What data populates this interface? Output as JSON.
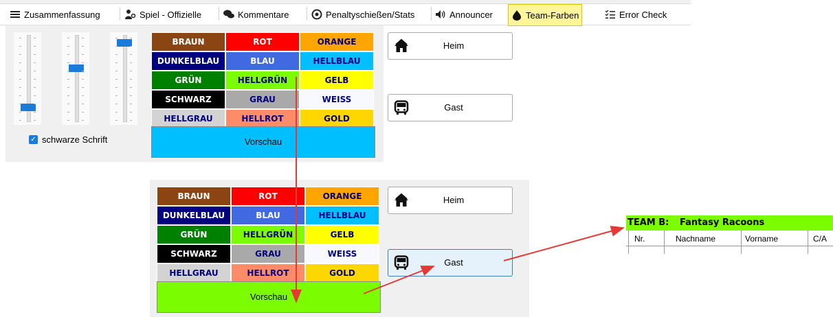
{
  "tabs": [
    {
      "label": "Zusammenfassung",
      "icon": "list-icon"
    },
    {
      "label": "Spiel - Offizielle",
      "icon": "users-icon"
    },
    {
      "label": "Kommentare",
      "icon": "comments-icon"
    },
    {
      "label": "Penaltyschießen/Stats",
      "icon": "target-icon"
    },
    {
      "label": "Announcer",
      "icon": "speaker-icon"
    },
    {
      "label": "Team-Farben",
      "icon": "paint-drop-icon",
      "active": true
    },
    {
      "label": "Error Check",
      "icon": "checklist-icon"
    }
  ],
  "colors": [
    {
      "label": "BRAUN",
      "bg": "#8b4513",
      "fg": "#ffffff"
    },
    {
      "label": "ROT",
      "bg": "#ff0000",
      "fg": "#ffffff"
    },
    {
      "label": "ORANGE",
      "bg": "#ffa500",
      "fg": "#000080"
    },
    {
      "label": "DUNKELBLAU",
      "bg": "#000080",
      "fg": "#ffffff"
    },
    {
      "label": "BLAU",
      "bg": "#4169e1",
      "fg": "#ffffff"
    },
    {
      "label": "HELLBLAU",
      "bg": "#00bfff",
      "fg": "#000080"
    },
    {
      "label": "GRÜN",
      "bg": "#008000",
      "fg": "#ffffff"
    },
    {
      "label": "HELLGRÜN",
      "bg": "#7cfc00",
      "fg": "#000080"
    },
    {
      "label": "GELB",
      "bg": "#ffff00",
      "fg": "#000080"
    },
    {
      "label": "SCHWARZ",
      "bg": "#000000",
      "fg": "#ffffff"
    },
    {
      "label": "GRAU",
      "bg": "#a9a9a9",
      "fg": "#000080"
    },
    {
      "label": "WEISS",
      "bg": "#f8f8ff",
      "fg": "#000080"
    },
    {
      "label": "HELLGRAU",
      "bg": "#d3d3d3",
      "fg": "#000080"
    },
    {
      "label": "HELLROT",
      "bg": "#ff8c69",
      "fg": "#000080"
    },
    {
      "label": "GOLD",
      "bg": "#ffd700",
      "fg": "#000080"
    }
  ],
  "panel1": {
    "sliders": [
      0.12,
      0.62,
      0.95
    ],
    "checkbox_label": "schwarze Schrift",
    "checkbox_checked": true,
    "preview_label": "Vorschau",
    "preview_color": "#00bfff",
    "home_label": "Heim",
    "away_label": "Gast"
  },
  "panel2": {
    "preview_label": "Vorschau",
    "preview_color": "#7cfc00",
    "home_label": "Heim",
    "away_label": "Gast"
  },
  "team": {
    "prefix": "TEAM B:",
    "name": "Fantasy Racoons",
    "header_color": "#7cfc00",
    "columns": [
      "Nr.",
      "Nachname",
      "Vorname",
      "C/A"
    ]
  },
  "accent": "#1a7bd8",
  "arrow_color": "#e53935"
}
